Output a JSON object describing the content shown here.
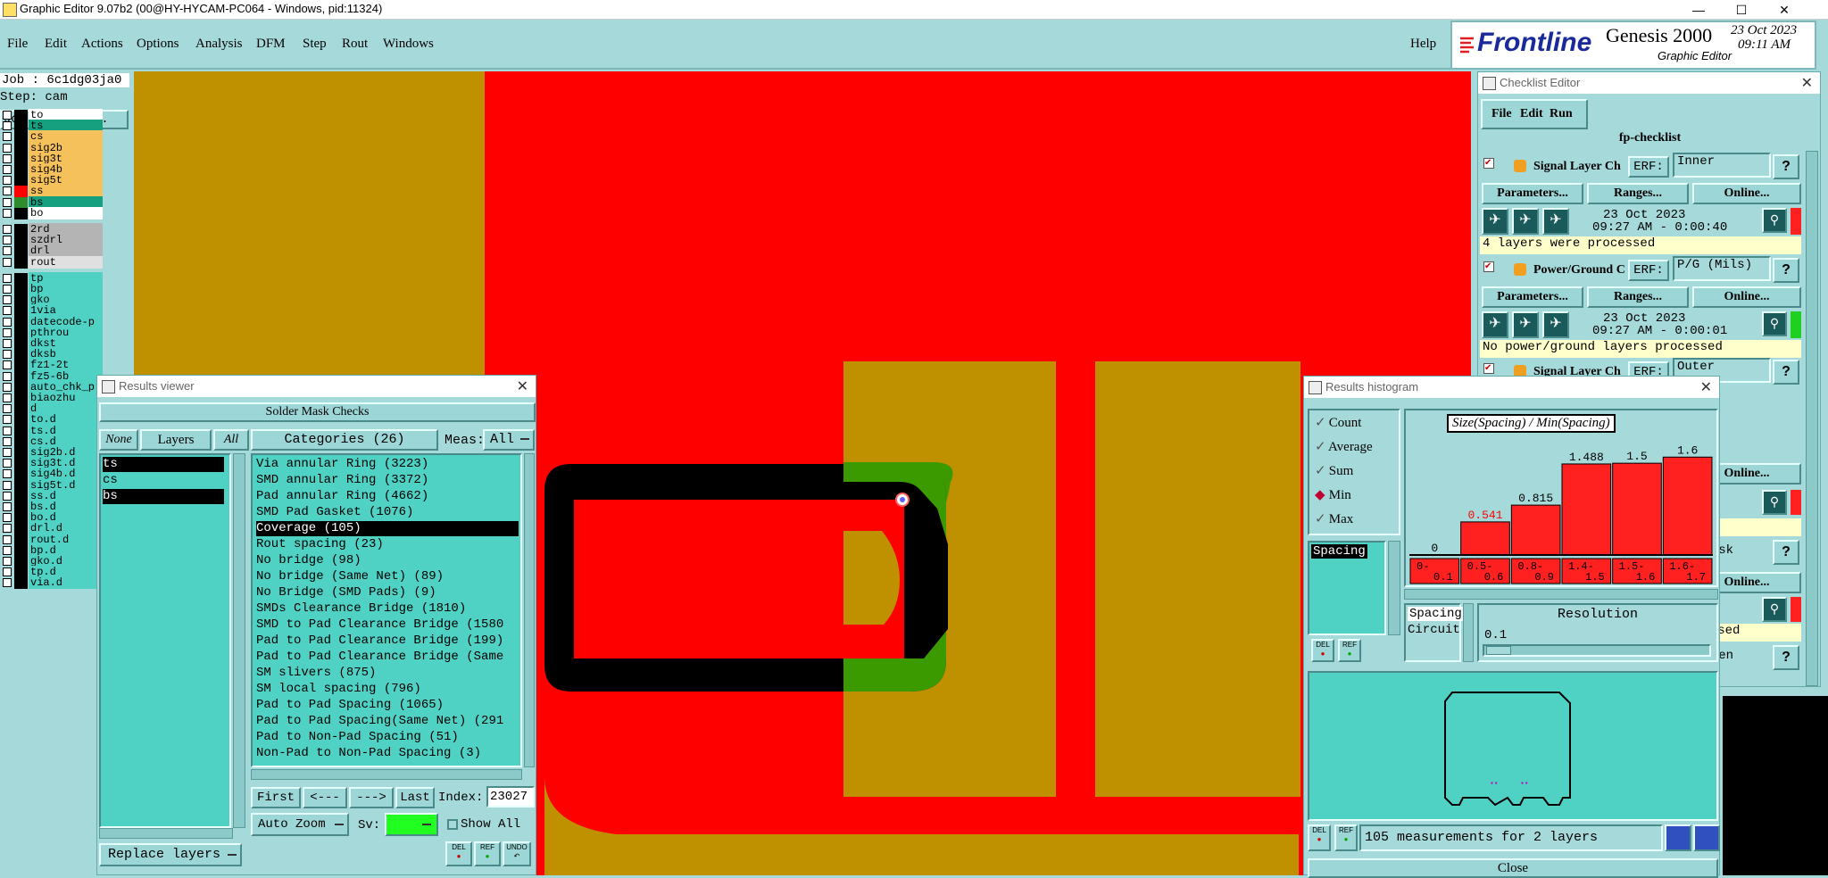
{
  "window": {
    "title": "Graphic Editor 9.07b2 (00@HY-HYCAM-PC064 - Windows, pid:11324)",
    "min": "—",
    "max": "☐",
    "close": "✕"
  },
  "menu": [
    "File",
    "Edit",
    "Actions",
    "Options",
    "Analysis",
    "DFM",
    "Step",
    "Rout",
    "Windows"
  ],
  "help": "Help",
  "brand": {
    "logo": "Frontline",
    "product": "Genesis 2000",
    "subtitle": "Graphic Editor",
    "date": "23 Oct 2023",
    "time": "09:11 AM"
  },
  "job": {
    "job": "Job : 6c1dg03ja0",
    "step": "Step: cam",
    "matrix": "Job Matrix ..."
  },
  "layers": [
    {
      "name": "to",
      "color": "#ffffff",
      "sw": "#000000"
    },
    {
      "name": "ts",
      "color": "#16a080",
      "sw": "#000000"
    },
    {
      "name": "cs",
      "color": "#f5c15a",
      "sw": "#000000"
    },
    {
      "name": "sig2b",
      "color": "#f5c15a",
      "sw": "#000000"
    },
    {
      "name": "sig3t",
      "color": "#f5c15a",
      "sw": "#000000"
    },
    {
      "name": "sig4b",
      "color": "#f5c15a",
      "sw": "#000000"
    },
    {
      "name": "sig5t",
      "color": "#f5c15a",
      "sw": "#000000"
    },
    {
      "name": "ss",
      "color": "#f5c15a",
      "sw": "#ff0000"
    },
    {
      "name": "bs",
      "color": "#16a080",
      "sw": "#2e8b2e"
    },
    {
      "name": "bo",
      "color": "#ffffff",
      "sw": "#000000"
    },
    {
      "name": "2rd",
      "color": "#b4b4b4",
      "sw": "#000000"
    },
    {
      "name": "szdrl",
      "color": "#b4b4b4",
      "sw": "#000000"
    },
    {
      "name": "drl",
      "color": "#b4b4b4",
      "sw": "#000000"
    },
    {
      "name": "rout",
      "color": "#e0e0e0",
      "sw": "#000000"
    },
    {
      "name": "tp",
      "color": "#4fd1c4",
      "sw": "#000000"
    },
    {
      "name": "bp",
      "color": "#4fd1c4",
      "sw": "#000000"
    },
    {
      "name": "gko",
      "color": "#4fd1c4",
      "sw": "#000000"
    },
    {
      "name": "1via",
      "color": "#4fd1c4",
      "sw": "#000000"
    },
    {
      "name": "datecode-p",
      "color": "#4fd1c4",
      "sw": "#000000"
    },
    {
      "name": "pthrou",
      "color": "#4fd1c4",
      "sw": "#000000"
    },
    {
      "name": "dkst",
      "color": "#4fd1c4",
      "sw": "#000000"
    },
    {
      "name": "dksb",
      "color": "#4fd1c4",
      "sw": "#000000"
    },
    {
      "name": "fz1-2t",
      "color": "#4fd1c4",
      "sw": "#000000"
    },
    {
      "name": "fz5-6b",
      "color": "#4fd1c4",
      "sw": "#000000"
    },
    {
      "name": "auto_chk_p",
      "color": "#4fd1c4",
      "sw": "#000000"
    },
    {
      "name": "biaozhu",
      "color": "#4fd1c4",
      "sw": "#000000"
    },
    {
      "name": "d",
      "color": "#4fd1c4",
      "sw": "#000000"
    },
    {
      "name": "to.d",
      "color": "#4fd1c4",
      "sw": "#000000"
    },
    {
      "name": "ts.d",
      "color": "#4fd1c4",
      "sw": "#000000"
    },
    {
      "name": "cs.d",
      "color": "#4fd1c4",
      "sw": "#000000"
    },
    {
      "name": "sig2b.d",
      "color": "#4fd1c4",
      "sw": "#000000"
    },
    {
      "name": "sig3t.d",
      "color": "#4fd1c4",
      "sw": "#000000"
    },
    {
      "name": "sig4b.d",
      "color": "#4fd1c4",
      "sw": "#000000"
    },
    {
      "name": "sig5t.d",
      "color": "#4fd1c4",
      "sw": "#000000"
    },
    {
      "name": "ss.d",
      "color": "#4fd1c4",
      "sw": "#000000"
    },
    {
      "name": "bs.d",
      "color": "#4fd1c4",
      "sw": "#000000"
    },
    {
      "name": "bo.d",
      "color": "#4fd1c4",
      "sw": "#000000"
    },
    {
      "name": "drl.d",
      "color": "#4fd1c4",
      "sw": "#000000"
    },
    {
      "name": "rout.d",
      "color": "#4fd1c4",
      "sw": "#000000"
    },
    {
      "name": "bp.d",
      "color": "#4fd1c4",
      "sw": "#000000"
    },
    {
      "name": "gko.d",
      "color": "#4fd1c4",
      "sw": "#000000"
    },
    {
      "name": "tp.d",
      "color": "#4fd1c4",
      "sw": "#000000"
    },
    {
      "name": "via.d",
      "color": "#4fd1c4",
      "sw": "#000000"
    }
  ],
  "checklist": {
    "title": "Checklist Editor",
    "menu": [
      "File",
      "Edit",
      "Run"
    ],
    "name": "fp-checklist",
    "erf": "ERF:",
    "params": "Parameters...",
    "ranges": "Ranges...",
    "online": "Online...",
    "help": "?",
    "items": [
      {
        "name": "Signal Layer Ch",
        "erf": "Inner",
        "date": "23 Oct 2023",
        "time": "09:27 AM - 0:00:40",
        "status": "4 layers were processed",
        "lamp": "#ff2020"
      },
      {
        "name": "Power/Ground C",
        "erf": "P/G (Mils)",
        "date": "23 Oct 2023",
        "time": "09:27 AM - 0:00:01",
        "status": "No power/ground layers processed",
        "lamp": "#20d020"
      },
      {
        "name": "Signal Layer Ch",
        "erf": "Outer"
      }
    ],
    "peek": [
      "rmask",
      "ressed",
      "creen"
    ]
  },
  "results": {
    "title": "Results viewer",
    "header": "Solder Mask Checks",
    "none": "None",
    "layers_label": "Layers",
    "all": "All",
    "layers": [
      "ts",
      "cs",
      "bs"
    ],
    "categories_label": "Categories (26)",
    "meas_label": "Meas:",
    "meas_value": "All",
    "categories": [
      "Via annular Ring (3223)",
      "SMD annular Ring (3372)",
      "Pad annular Ring (4662)",
      "SMD Pad Gasket (1076)",
      "Coverage (105)",
      "Rout spacing (23)",
      "No bridge (98)",
      "No bridge (Same Net) (89)",
      "No Bridge (SMD Pads) (9)",
      "SMDs Clearance Bridge (1810)",
      "SMD to Pad Clearance Bridge (1580",
      "Pad to Pad Clearance Bridge (199)",
      "Pad to Pad Clearance Bridge (Same",
      "SM slivers (875)",
      "SM local spacing (796)",
      "Pad to Pad Spacing (1065)",
      "Pad to Pad Spacing(Same Net) (291",
      "Pad to Non-Pad Spacing (51)",
      "Non-Pad to Non-Pad Spacing (3)"
    ],
    "selected_index": 4,
    "first": "First",
    "prev": "<---",
    "next": "--->",
    "last": "Last",
    "index_label": "Index:",
    "index_value": "23027",
    "auto_zoom": "Auto Zoom",
    "sv": "Sv:",
    "show_all": "Show All",
    "replace": "Replace layers",
    "del": "DEL",
    "ref": "REF",
    "undo": "UNDO"
  },
  "histogram": {
    "title": "Results histogram",
    "options": [
      {
        "label": "Count",
        "on": false
      },
      {
        "label": "Average",
        "on": false
      },
      {
        "label": "Sum",
        "on": false
      },
      {
        "label": "Min",
        "on": true
      },
      {
        "label": "Max",
        "on": false
      }
    ],
    "attr_list": [
      "Spacing"
    ],
    "chart_title": "Size(Spacing) / Min(Spacing)",
    "side_list": [
      "Spacing",
      "Circuit"
    ],
    "resolution_label": "Resolution",
    "resolution_value": "0.1",
    "summary": "105 measurements for 2 layers",
    "close": "Close",
    "del": "DEL",
    "ref": "REF"
  },
  "chart_data": {
    "type": "bar",
    "title": "Size(Spacing) / Min(Spacing)",
    "categories": [
      "0-0.1",
      "0.5-0.6",
      "0.8-0.9",
      "1.4-1.5",
      "1.5-1.6",
      "1.6-1.7"
    ],
    "values": [
      0,
      0.541,
      0.815,
      1.488,
      1.5,
      1.6
    ],
    "value_labels": [
      "0",
      "0.541",
      "0.815",
      "1.488",
      "1.5",
      "1.6"
    ],
    "ylim": [
      0,
      1.75
    ],
    "colors": {
      "bar": "#ff2020",
      "highlight_label": "#ff0000",
      "label": "#000000"
    }
  },
  "colors": {
    "bg": "#a6dada",
    "copper": "#bf9000",
    "mask": "#ff0000",
    "dark": "#000000",
    "green": "#3a9a00"
  }
}
